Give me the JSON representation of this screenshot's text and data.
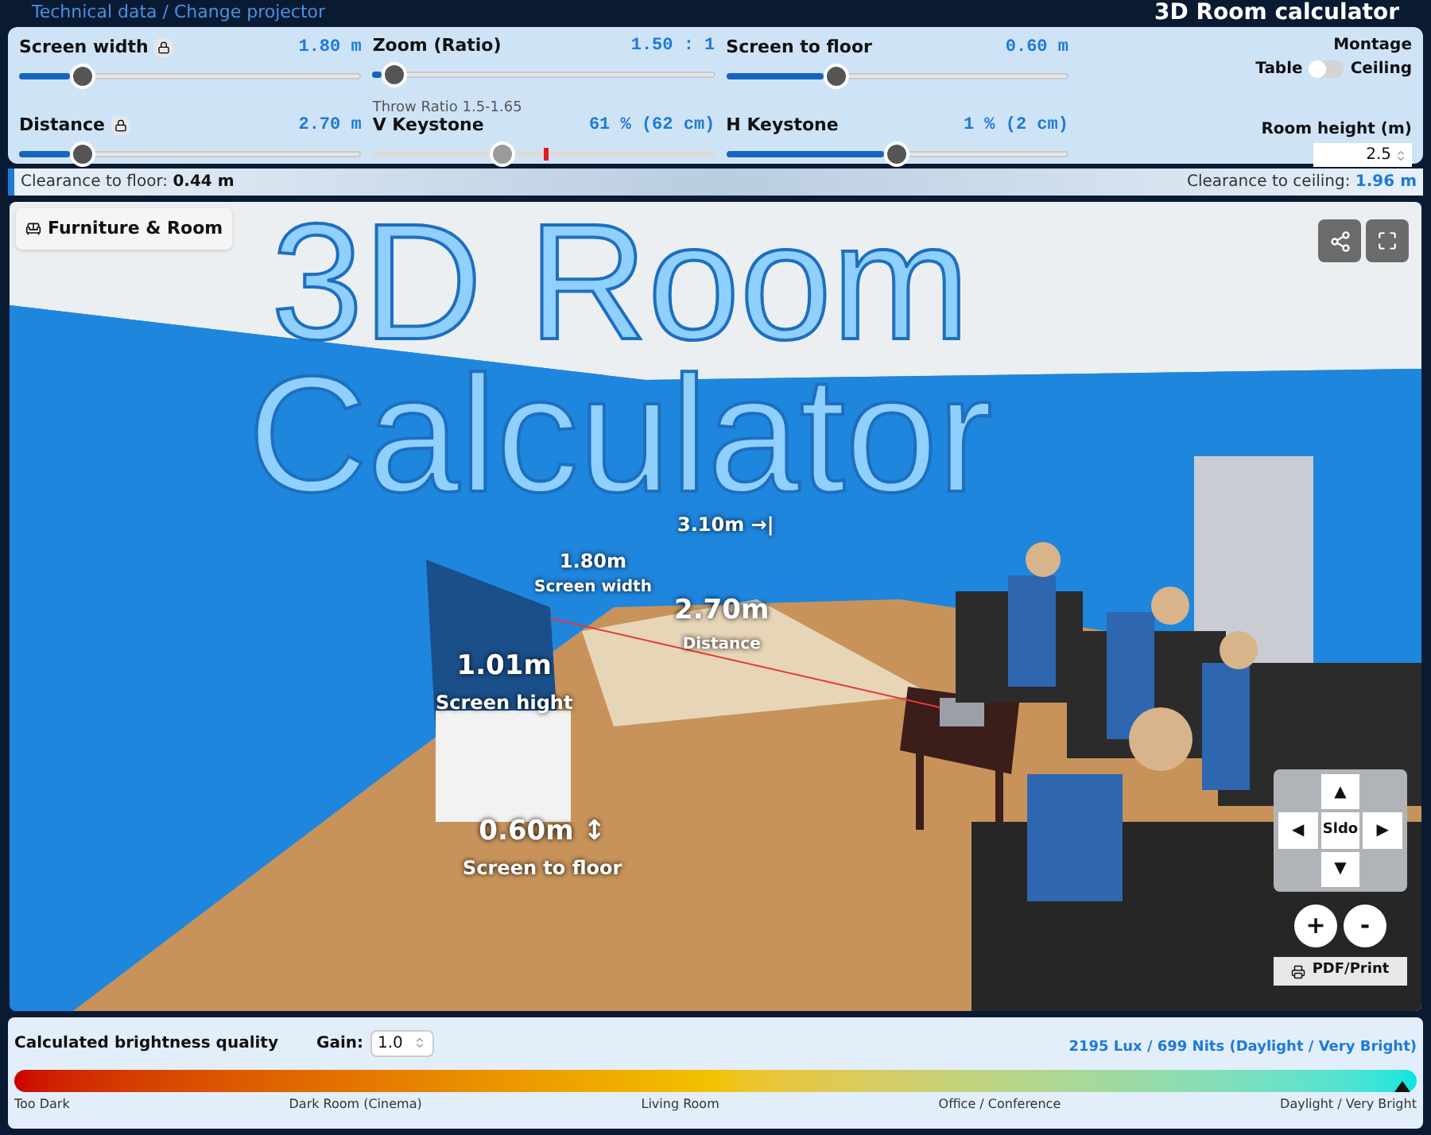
{
  "header": {
    "breadcrumb": "Technical data / Change projector",
    "title": "3D Room calculator"
  },
  "sliders": [
    {
      "label": "Screen width",
      "locked": true,
      "reading": "1.80 m",
      "level": 0.16,
      "kind": "fill"
    },
    {
      "label": "Zoom (Ratio)",
      "locked": false,
      "reading": "1.50 : 1",
      "level": 0.03,
      "kind": "fill",
      "note": "Throw Ratio 1.5-1.65"
    },
    {
      "label": "Screen to floor",
      "locked": false,
      "reading": "0.60 m",
      "level": 0.31,
      "kind": "fill"
    },
    {
      "label": "Distance",
      "locked": true,
      "reading": "2.70 m",
      "level": 0.16,
      "kind": "fill"
    },
    {
      "label": "V Keystone",
      "locked": false,
      "reading": "61 % (62 cm)",
      "level": 0.37,
      "kind": "marker"
    },
    {
      "label": "H Keystone",
      "locked": false,
      "reading": "1 % (2 cm)",
      "level": 0.5,
      "kind": "fill"
    }
  ],
  "montage": {
    "label": "Montage",
    "off_label": "Table",
    "on_label": "Ceiling",
    "on": false
  },
  "room_height": {
    "label": "Room height (m)",
    "value": "2.5"
  },
  "clearance": {
    "floor_label": "Clearance to floor:",
    "floor_value": "0.44 m",
    "ceiling_label": "Clearance to ceiling:",
    "ceiling_value": "1.96 m"
  },
  "viewport": {
    "furniture_button": "Furniture & Room",
    "overlay_title": [
      "3D Room",
      "Calculator"
    ],
    "labels": [
      {
        "value": "3.10m →|"
      },
      {
        "value": "1.80m",
        "caption": "Screen width"
      },
      {
        "value": "2.70m",
        "caption": "Distance"
      },
      {
        "value": "1.01m",
        "caption": "Screen hight"
      },
      {
        "value": "0.60m ↕",
        "caption": "Screen to floor"
      }
    ],
    "nav": {
      "up": "▲",
      "left": "◀",
      "center": "Sldo",
      "right": "▶",
      "down": "▼"
    },
    "zoom_in": "+",
    "zoom_out": "-",
    "print": "PDF/Print"
  },
  "brightness": {
    "label": "Calculated brightness quality",
    "gain_label": "Gain:",
    "gain_value": "1.0",
    "reading": "2195 Lux / 699 Nits (Daylight / Very Bright)",
    "level": 0.99,
    "scale": [
      "Too Dark",
      "Dark Room (Cinema)",
      "Living Room",
      "Office / Conference",
      "Daylight / Very Bright"
    ]
  }
}
